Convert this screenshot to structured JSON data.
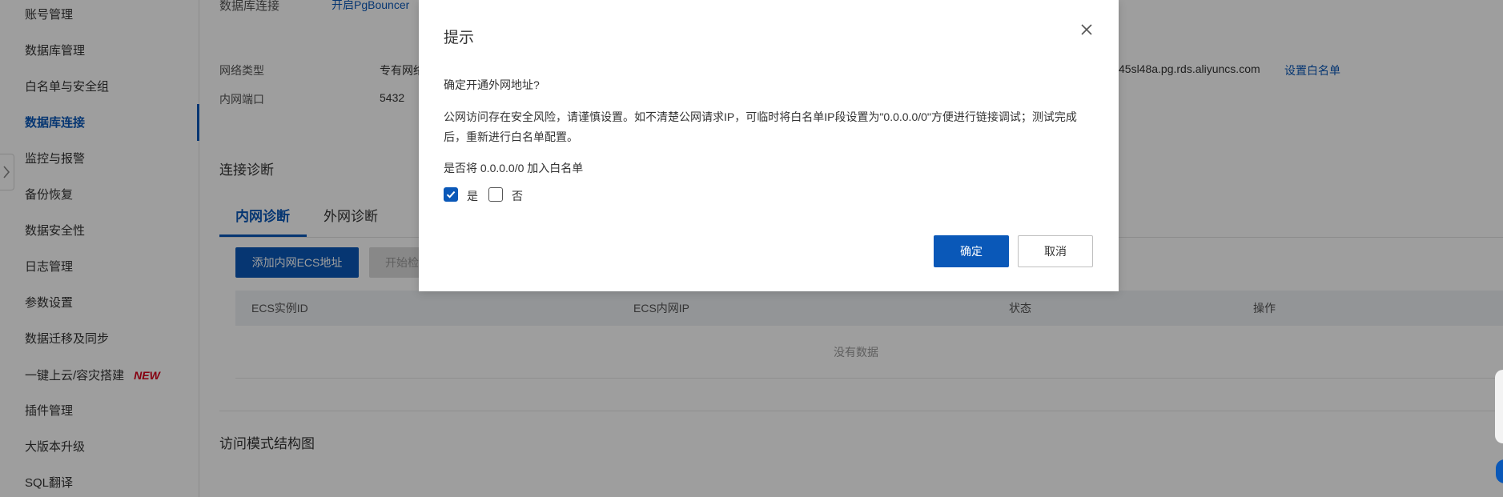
{
  "sidebar": {
    "items": [
      {
        "label": "账号管理"
      },
      {
        "label": "数据库管理"
      },
      {
        "label": "白名单与安全组"
      },
      {
        "label": "数据库连接"
      },
      {
        "label": "监控与报警"
      },
      {
        "label": "备份恢复"
      },
      {
        "label": "数据安全性"
      },
      {
        "label": "日志管理"
      },
      {
        "label": "参数设置"
      },
      {
        "label": "数据迁移及同步"
      },
      {
        "label": "一键上云/容灾搭建",
        "badge": "NEW"
      },
      {
        "label": "插件管理"
      },
      {
        "label": "大版本升级"
      },
      {
        "label": "SQL翻译"
      }
    ],
    "active": "数据库连接"
  },
  "main": {
    "db_conn_label": "数据库连接",
    "pgbouncer_link": "开启PgBouncer",
    "network_type_label": "网络类型",
    "network_type_value": "专有网络",
    "host_value_partial": "45sl48a.pg.rds.aliyuncs.com",
    "whitelist_link": "设置白名单",
    "port_label": "内网端口",
    "port_value": "5432",
    "diag_title": "连接诊断",
    "tabs": [
      {
        "label": "内网诊断"
      },
      {
        "label": "外网诊断"
      }
    ],
    "add_ecs_button": "添加内网ECS地址",
    "start_button_partial": "开始检",
    "table_headers": [
      "ECS实例ID",
      "ECS内网IP",
      "状态",
      "操作"
    ],
    "empty_text": "没有数据",
    "access_title": "访问模式结构图"
  },
  "dialog": {
    "title": "提示",
    "question": "确定开通外网地址?",
    "warning": "公网访问存在安全风险，请谨慎设置。如不清楚公网请求IP，可临时将白名单IP段设置为\"0.0.0.0/0\"方便进行链接调试；测试完成后，重新进行白名单配置。",
    "add_whitelist_question": "是否将 0.0.0.0/0 加入白名单",
    "option_yes": "是",
    "option_no": "否",
    "yes_checked": true,
    "ok_label": "确定",
    "cancel_label": "取消"
  },
  "colors": {
    "accent": "#0a58b8",
    "badge": "#d9001b"
  }
}
